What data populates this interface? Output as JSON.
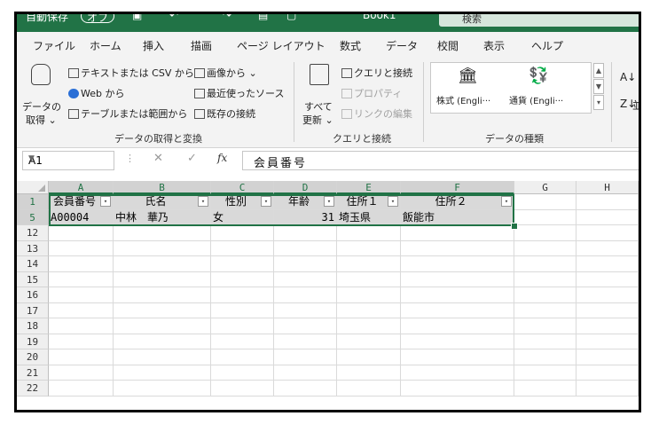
{
  "titlebar": {
    "autosave_label": "自動保存",
    "toggle_label": "オフ",
    "book_name": "Book1",
    "search_placeholder": "検索"
  },
  "tabs": [
    "ファイル",
    "ホーム",
    "挿入",
    "描画",
    "ページ レイアウト",
    "数式",
    "データ",
    "校閲",
    "表示",
    "ヘルプ"
  ],
  "active_tab": "データ",
  "ribbon": {
    "get_data": {
      "label_line1": "データの",
      "label_line2": "取得 ⌄"
    },
    "from_text_csv": "テキストまたは CSV から",
    "from_web": "Web から",
    "from_table": "テーブルまたは範囲から",
    "from_image": "画像から ⌄",
    "recent_sources": "最近使ったソース",
    "existing_connections": "既存の接続",
    "group1_label": "データの取得と変換",
    "refresh_all": {
      "label_line1": "すべて",
      "label_line2": "更新 ⌄"
    },
    "queries_connections": "クエリと接続",
    "properties": "プロパティ",
    "edit_links": "リンクの編集",
    "group2_label": "クエリと接続",
    "stocks": "株式 (Engli···",
    "currencies": "通貨 (Engli···",
    "group3_label": "データの種類",
    "sort_label": "並"
  },
  "formula_bar": {
    "name_box": "A1",
    "content": "会員番号"
  },
  "columns": [
    "A",
    "B",
    "C",
    "D",
    "E",
    "F",
    "G",
    "H"
  ],
  "selected_columns": [
    "A",
    "B",
    "C",
    "D",
    "E",
    "F"
  ],
  "rows": [
    "1",
    "5",
    "12",
    "13",
    "14",
    "15",
    "16",
    "17",
    "18",
    "19",
    "20",
    "21",
    "22"
  ],
  "header_row": [
    "会員番号",
    "氏名",
    "性別",
    "年齢",
    "住所１",
    "住所２"
  ],
  "data_row": [
    "A00004",
    "中林　華乃",
    "女",
    "31",
    "埼玉県",
    "飯能市"
  ],
  "filter_icons": [
    "▾",
    "▾",
    "▾",
    "▾",
    "▾",
    "▾"
  ],
  "filtered_column_icon": "▾",
  "colors": {
    "accent": "#217346",
    "selection": "#d9d9d9"
  }
}
